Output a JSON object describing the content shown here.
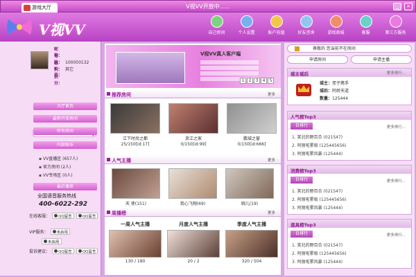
{
  "titlebar": {
    "hall_tab": "游戏大厅",
    "title": "V视VV开放中......",
    "minimize": "_",
    "close": "×"
  },
  "header": {
    "brand": "V视VV",
    "nav": [
      "自己房间",
      "个人设置",
      "账户充值",
      "好友咨询",
      "游戏商城",
      "客服",
      "第三方服务"
    ]
  },
  "profile": {
    "labels": [
      "昵称：",
      "号码：",
      "级别：",
      "K币：",
      "积分："
    ],
    "values": [
      "",
      "100050132",
      "其它",
      "",
      ""
    ]
  },
  "search": {
    "placeholder": ""
  },
  "left_buttons": [
    "大厅首页",
    "最新开奖房间",
    "所有房间",
    "内部娱乐"
  ],
  "zones": [
    "VV直播区 (657人)",
    "官方房间 (2人)",
    "VV专场区 (0人)"
  ],
  "left_footer_button": "最近播放",
  "hotline": {
    "label": "全国语音服务热线",
    "number": "400-6022-292"
  },
  "service": {
    "online_label": "在线客服：",
    "vip_label": "VIP服务：",
    "complaint_label": "投诉建议：",
    "qq_text": "QQ留言",
    "unused_text": "未启用"
  },
  "banner": {
    "title": "V视VV真人客户端",
    "pager": [
      "1",
      "2",
      "3",
      "4",
      "5"
    ]
  },
  "sections": {
    "recommended": {
      "title": "推荐房间",
      "more": "更多"
    },
    "popular": {
      "title": "人气主播",
      "more": "更多"
    },
    "weekly": {
      "title": "周播榜",
      "more": "更多"
    }
  },
  "rooms": [
    {
      "name": "江下时尚之都",
      "stat": "25/150[id:17]"
    },
    {
      "name": "浙江之家",
      "stat": "0/150[id:99]"
    },
    {
      "name": "鹏城之窗",
      "stat": "0/150[id:666]"
    }
  ],
  "anchors": [
    {
      "name": "天 使(151)"
    },
    {
      "name": "我心飞翔(69)"
    },
    {
      "name": "婉儿(19)"
    }
  ],
  "weekly": [
    {
      "title": "一周人气主播",
      "stat": "130 / 180"
    },
    {
      "title": "月度人气主播",
      "stat": "20 / 2"
    },
    {
      "title": "季度人气主播",
      "stat": "320 / 504"
    }
  ],
  "right": {
    "notice": "尊敬的 您当前不在房间",
    "apply_room": "申请房间",
    "apply_anchor": "申请主播",
    "castle": {
      "title": "城主城后",
      "more": "更多排行...",
      "rows": [
        {
          "k": "城主：",
          "v": "侄子携手"
        },
        {
          "k": "城后：",
          "v": "阿娇天道"
        },
        {
          "k": "数量：",
          "v": "125444"
        }
      ]
    },
    "ranks": [
      {
        "title": "人气榜Top3",
        "tag": "日排行",
        "more": "更多排行...",
        "items": [
          "1. 笑北的野百合 (021547)",
          "2. 阿丽啦累极 (125445656)",
          "3. 阿丽啦累风暴 (125444)"
        ]
      },
      {
        "title": "消费榜Top3",
        "tag": "日排行",
        "more": "更多排行...",
        "items": [
          "1. 笑北的野百合 (021547)",
          "2. 阿丽啦累极 (125445656)",
          "3. 阿丽啦累风暴 (125444)"
        ]
      },
      {
        "title": "道具榜Top3",
        "tag": "日排行",
        "more": "更多排行...",
        "items": [
          "1. 笑北的野百合 (021547)",
          "2. 阿丽啦累极 (125445656)",
          "3. 阿丽啦累风暴 (125444)"
        ]
      }
    ]
  },
  "colors": {
    "accent": "#c24bc9",
    "section": "#a01ba0",
    "panel": "#f7dcf6"
  }
}
